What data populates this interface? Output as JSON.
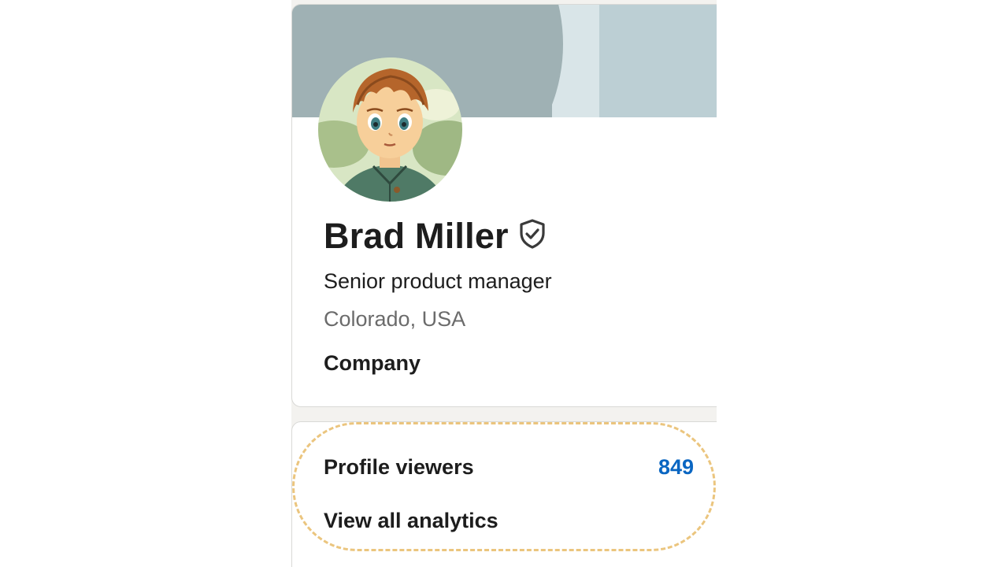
{
  "profile": {
    "name": "Brad Miller",
    "headline": "Senior product manager",
    "location": "Colorado, USA",
    "company": "Company",
    "verified_icon": "shield-check-icon",
    "colors": {
      "banner": "#9fb1b4",
      "banner_light": "#d9e5e8",
      "banner_right": "#bccfd4"
    }
  },
  "analytics": {
    "viewers_label": "Profile viewers",
    "viewers_count": "849",
    "view_all_label": "View all analytics",
    "colors": {
      "count": "#0a66c2",
      "highlight": "#ebc57e"
    }
  }
}
